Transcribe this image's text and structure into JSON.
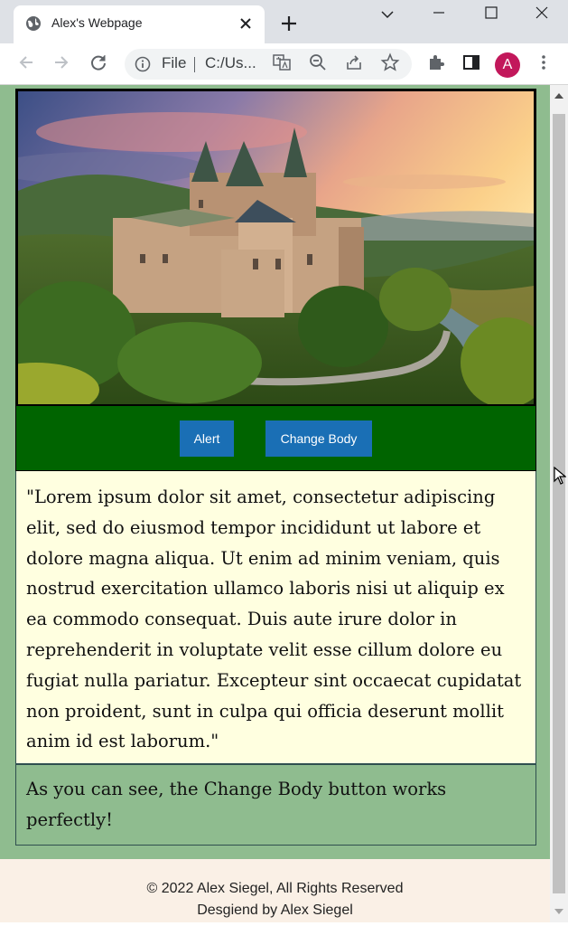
{
  "browser": {
    "tab_title": "Alex's Webpage",
    "omnibox_scheme": "File",
    "omnibox_path": "C:/Us...",
    "profile_initial": "A",
    "icons": [
      "globe-icon",
      "close-icon",
      "plus-icon",
      "chevron-down-icon",
      "minimize-icon",
      "maximize-icon",
      "window-close-icon",
      "back-icon",
      "forward-icon",
      "reload-icon",
      "info-icon",
      "translate-icon",
      "zoom-out-icon",
      "share-icon",
      "star-icon",
      "extensions-icon",
      "side-panel-icon",
      "kebab-menu-icon"
    ],
    "accent_color": "#c2185b"
  },
  "page": {
    "hero_alt": "castle",
    "buttons": {
      "alert_label": "Alert",
      "change_body_label": "Change Body"
    },
    "lorem_text": "\"Lorem ipsum dolor sit amet, consectetur adipiscing elit, sed do eiusmod tempor incididunt ut labore et dolore magna aliqua. Ut enim ad minim veniam, quis nostrud exercitation ullamco laboris nisi ut aliquip ex ea commodo consequat. Duis aute irure dolor in reprehenderit in voluptate velit esse cillum dolore eu fugiat nulla pariatur. Excepteur sint occaecat cupidatat non proident, sunt in culpa qui officia deserunt mollit anim id est laborum.\"",
    "note_text": "As you can see, the Change Body button works perfectly!",
    "footer": {
      "copyright": "© 2022 Alex Siegel, All Rights Reserved",
      "designed_by": "Desgiend by Alex Siegel"
    },
    "colors": {
      "page_bg": "#8fbc8f",
      "button_bar": "#006400",
      "button": "#1a6fb5",
      "text_panel": "#ffffe0",
      "footer_bg": "#faf0e6"
    }
  }
}
